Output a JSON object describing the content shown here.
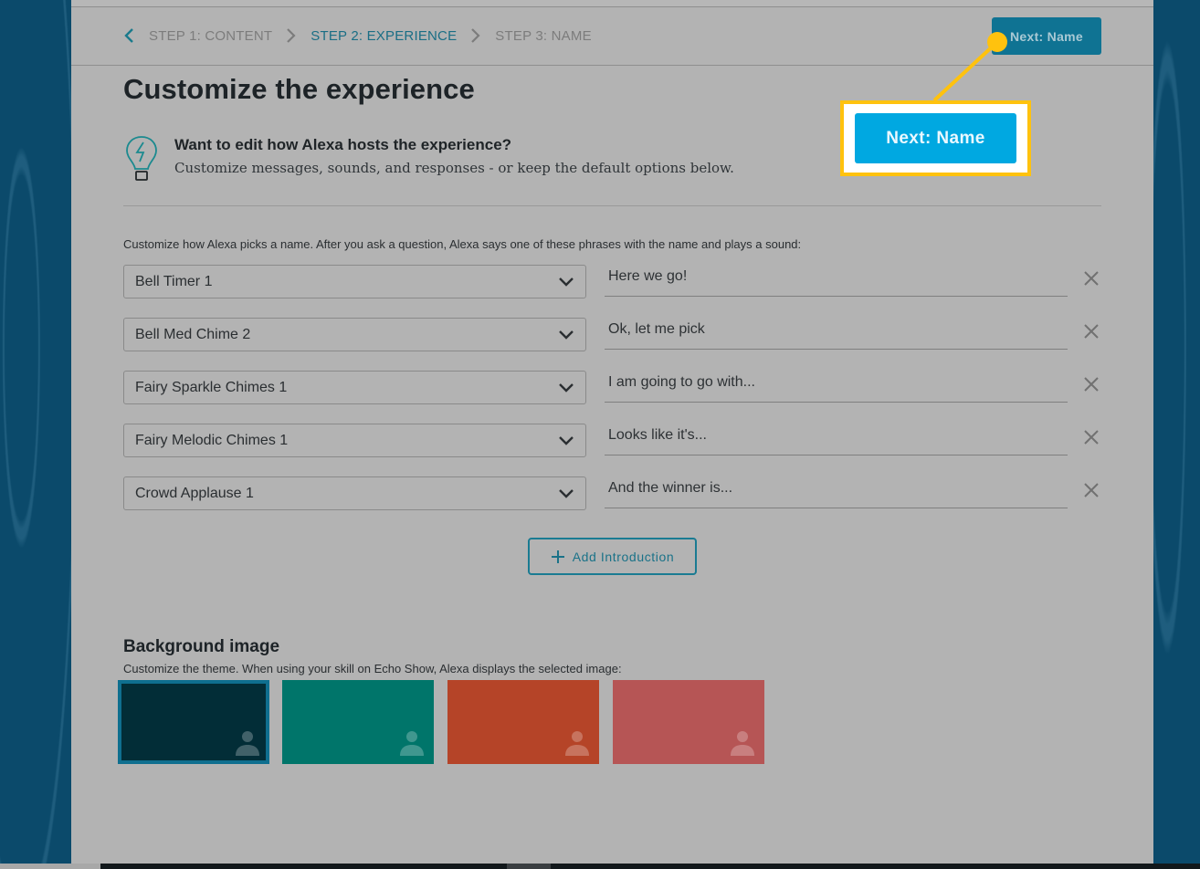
{
  "breadcrumb": {
    "back_icon": "chevron-left-icon",
    "steps": [
      {
        "label": "STEP 1: CONTENT",
        "active": false
      },
      {
        "label": "STEP 2: EXPERIENCE",
        "active": true
      },
      {
        "label": "STEP 3: NAME",
        "active": false
      }
    ]
  },
  "header": {
    "next_button_label": "Next: Name"
  },
  "page": {
    "title": "Customize the experience",
    "tip": {
      "icon": "lightbulb-icon",
      "heading": "Want to edit how Alexa hosts the experience?",
      "subtext": "Customize messages, sounds, and responses - or keep the default options below."
    }
  },
  "introductions": {
    "description": "Customize how Alexa picks a name. After you ask a question, Alexa says one of these phrases with the name and plays a sound:",
    "rows": [
      {
        "sound": "Bell Timer 1",
        "phrase": "Here we go!"
      },
      {
        "sound": "Bell Med Chime 2",
        "phrase": "Ok, let me pick"
      },
      {
        "sound": "Fairy Sparkle Chimes 1",
        "phrase": "I am going to go with..."
      },
      {
        "sound": "Fairy Melodic Chimes 1",
        "phrase": "Looks like it's..."
      },
      {
        "sound": "Crowd Applause 1",
        "phrase": "And the winner is..."
      }
    ],
    "add_button_label": "Add Introduction"
  },
  "background": {
    "title": "Background image",
    "description": "Customize the theme. When using your skill on Echo Show, Alexa displays the selected image:",
    "swatches": [
      {
        "color": "#022d37",
        "selected": true
      },
      {
        "color": "#00756a",
        "selected": false
      },
      {
        "color": "#b54428",
        "selected": false
      },
      {
        "color": "#b65555",
        "selected": false
      }
    ]
  },
  "callout": {
    "button_label": "Next: Name",
    "highlight_color": "#ffc20e",
    "button_color": "#00a8e1"
  },
  "colors": {
    "accent": "#1a6e85",
    "page_background": "#b3b3b3",
    "side_background": "#0b4a6b"
  }
}
